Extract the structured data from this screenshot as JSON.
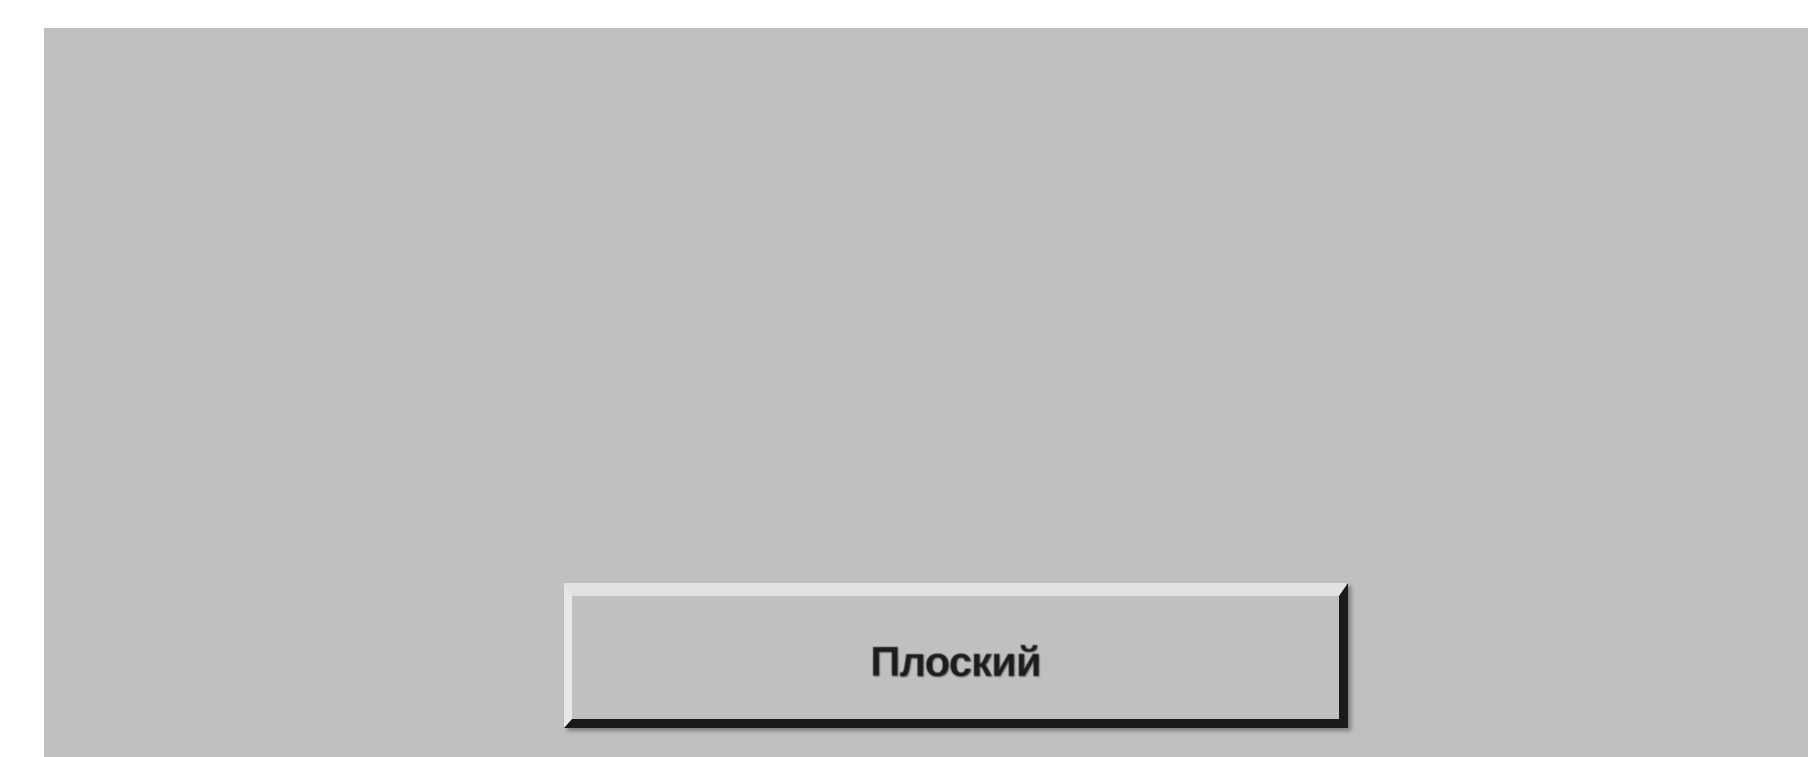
{
  "dialog": {
    "background_color": "#c0c0c0",
    "button": {
      "label": "Плоский"
    }
  }
}
